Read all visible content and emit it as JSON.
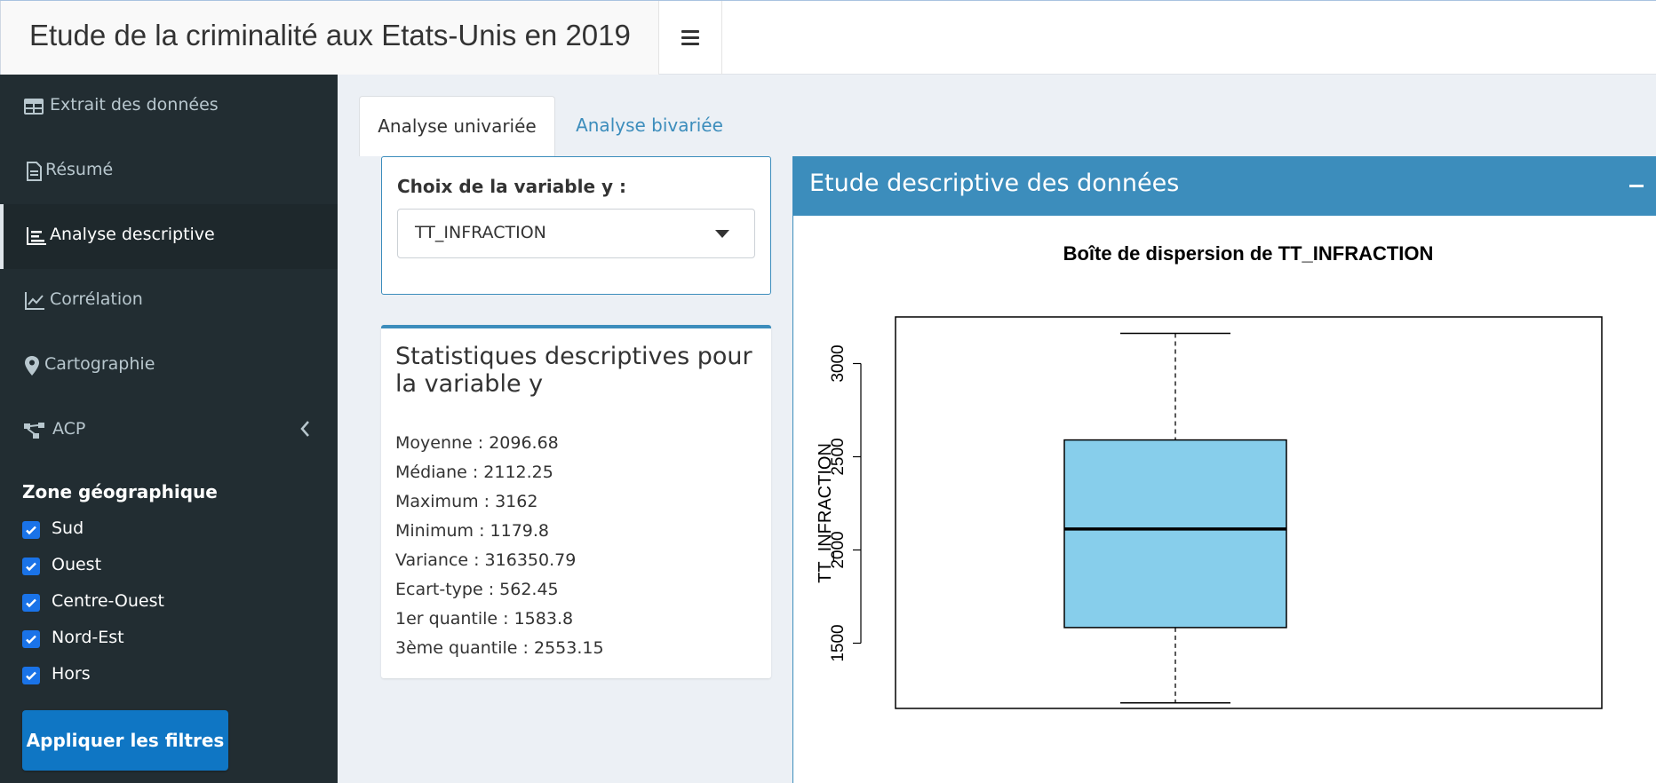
{
  "header": {
    "title": "Etude de la criminalité aux Etats-Unis en 2019"
  },
  "sidebar": {
    "items": [
      {
        "label": "Extrait des données",
        "icon": "table-icon"
      },
      {
        "label": "Résumé",
        "icon": "file-icon"
      },
      {
        "label": "Analyse descriptive",
        "icon": "bar-chart-icon",
        "active": true
      },
      {
        "label": "Corrélation",
        "icon": "line-chart-icon"
      },
      {
        "label": "Cartographie",
        "icon": "map-marker-icon"
      },
      {
        "label": "ACP",
        "icon": "sitemap-icon"
      }
    ],
    "zone_title": "Zone géographique",
    "zones": [
      {
        "label": "Sud",
        "checked": true
      },
      {
        "label": "Ouest",
        "checked": true
      },
      {
        "label": "Centre-Ouest",
        "checked": true
      },
      {
        "label": "Nord-Est",
        "checked": true
      },
      {
        "label": "Hors",
        "checked": true
      }
    ],
    "apply_label": "Appliquer les filtres"
  },
  "tabs": [
    {
      "label": "Analyse univariée",
      "active": true
    },
    {
      "label": "Analyse bivariée",
      "active": false
    }
  ],
  "variable_select": {
    "label": "Choix de la variable y :",
    "value": "TT_INFRACTION"
  },
  "stats": {
    "title": "Statistiques descriptives pour la variable y",
    "lines": [
      "Moyenne : 2096.68",
      "Médiane : 2112.25",
      "Maximum : 3162",
      "Minimum : 1179.8",
      "Variance : 316350.79",
      "Ecart-type : 562.45",
      "1er quantile : 1583.8",
      "3ème quantile : 2553.15"
    ]
  },
  "main_box": {
    "title": "Etude descriptive des données"
  },
  "colors": {
    "accent": "#3c8dbc",
    "sidebar": "#222d32",
    "box_fill": "#87ceeb",
    "button": "#0f76c4"
  },
  "chart_data": {
    "type": "box",
    "title": "Boîte de dispersion de TT_INFRACTION",
    "ylabel": "TT_INFRACTION",
    "xlabel": "",
    "ylim": [
      1150,
      3250
    ],
    "yticks": [
      1500,
      2000,
      2500,
      3000
    ],
    "whisker_low": 1179.8,
    "q1": 1583.8,
    "median": 2112.25,
    "q3": 2590,
    "whisker_high": 3162,
    "box_color": "#87ceeb",
    "grid": false
  }
}
